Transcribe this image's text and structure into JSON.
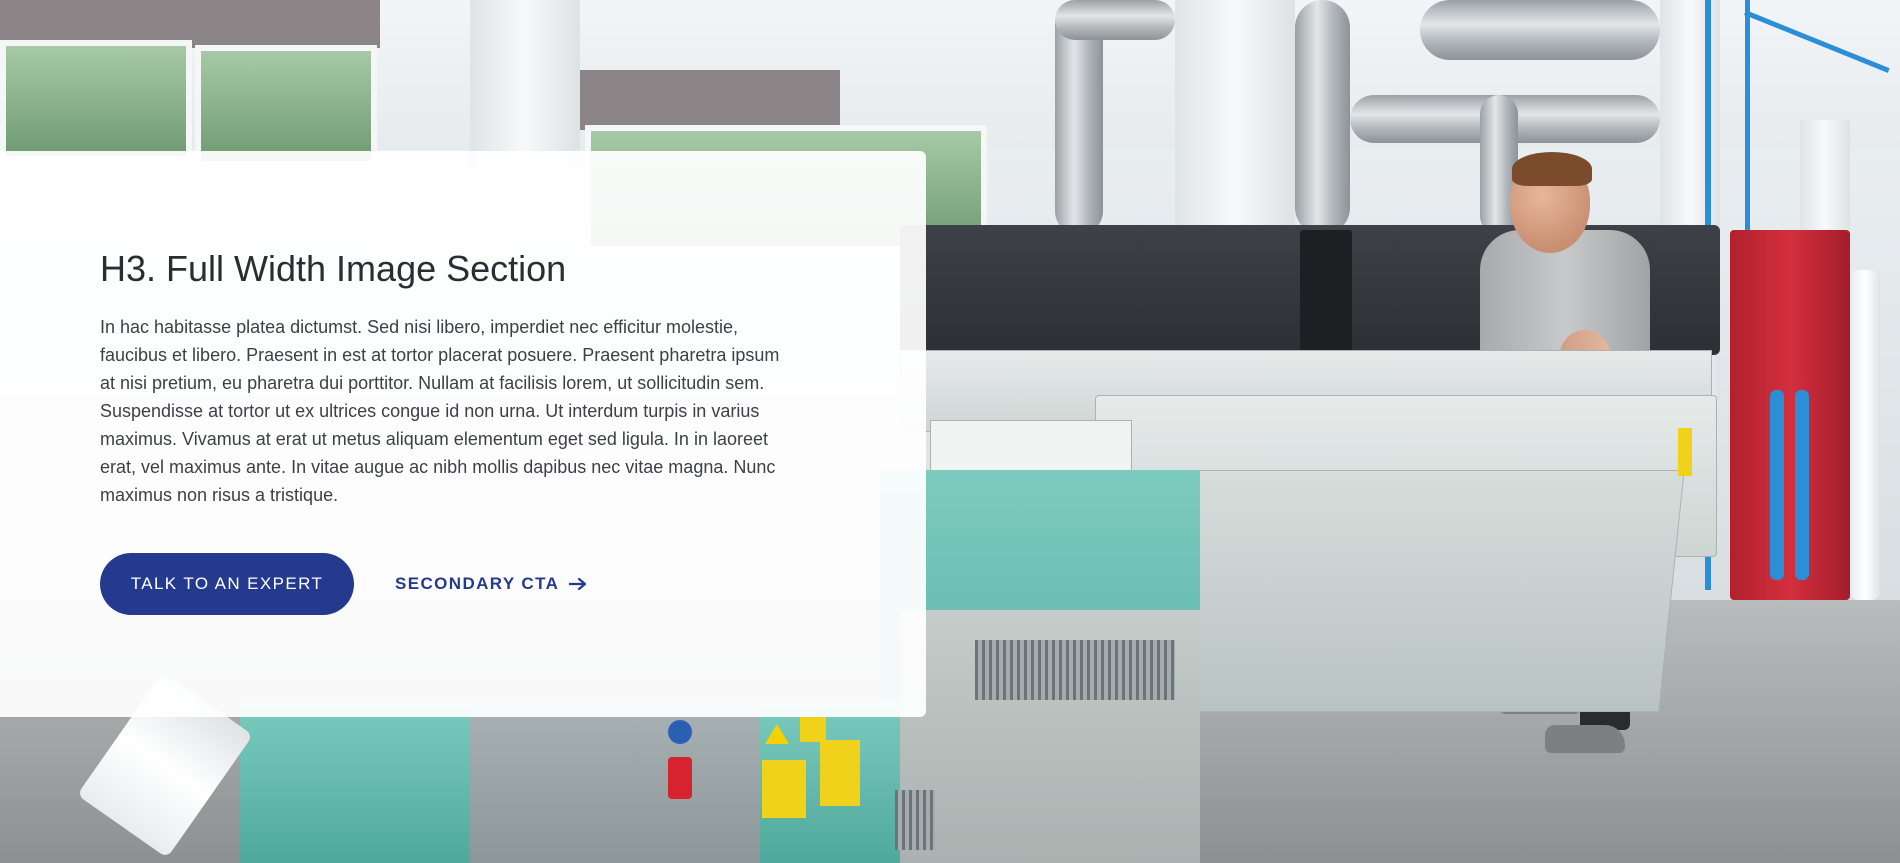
{
  "section": {
    "heading": "H3. Full Width Image Section",
    "body": "In hac habitasse platea dictumst. Sed nisi libero, imperdiet nec efficitur molestie, faucibus et libero. Praesent in est at tortor placerat posuere. Praesent pharetra ipsum at nisi pretium, eu pharetra dui porttitor. Nullam at facilisis lorem, ut sollicitudin sem. Suspendisse at tortor ut ex ultrices congue id non urna. Ut interdum turpis in varius maximus. Vivamus at erat ut metus aliquam elementum eget sed ligula. In in laoreet erat, vel maximus ante. In vitae augue ac nibh mollis dapibus nec vitae magna. Nunc maximus non risus a tristique.",
    "primary_cta": "TALK TO AN EXPERT",
    "secondary_cta": "SECONDARY CTA",
    "secondary_cta_icon": "arrow-right-icon"
  },
  "background": {
    "image": "industrial-print-shop-photo"
  },
  "colors": {
    "accent": "#233a8e",
    "heading": "#2b2d33",
    "body_text": "#3d4048",
    "card_bg": "#ffffff"
  }
}
